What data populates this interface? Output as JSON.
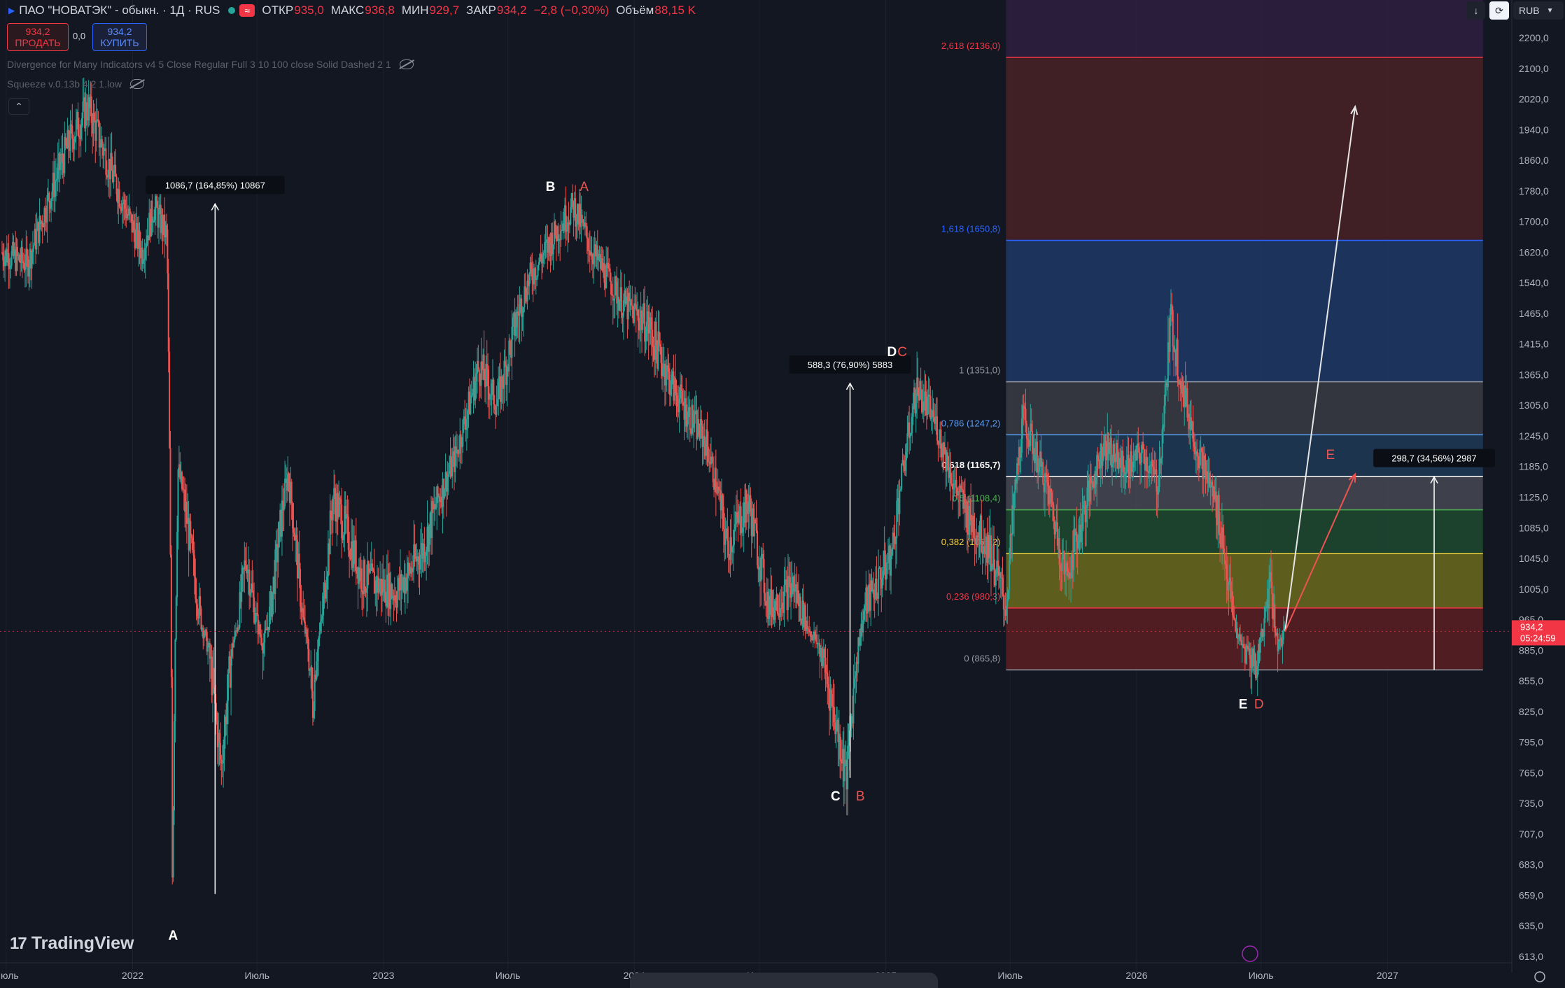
{
  "header": {
    "symbol": "ПАО \"НОВАТЭК\" - обыкн. · 1Д · RUS",
    "open_label": "ОТКР",
    "open": "935,0",
    "high_label": "МАКС",
    "high": "936,8",
    "low_label": "МИН",
    "low": "929,7",
    "close_label": "ЗАКР",
    "close": "934,2",
    "change": "−2,8 (−0,30%)",
    "volume_label": "Объём",
    "volume": "88,15 K",
    "badge": "≈"
  },
  "trade": {
    "sell_price": "934,2",
    "sell_label": "ПРОДАТЬ",
    "spread": "0,0",
    "buy_price": "934,2",
    "buy_label": "КУПИТЬ"
  },
  "indicators": [
    "Divergence for Many Indicators v4 5 Close Regular Full 3 10 100 close Solid Dashed 2 1",
    "Squeeze v.0.13b 4 2 1.low"
  ],
  "currency": "RUB",
  "watermark": "TradingView",
  "colors": {
    "background": "#131722",
    "candle_up": "#26a69a",
    "candle_down": "#ef5350",
    "last_price": "#f23645",
    "fib_236": "#f23645",
    "fib_382": "#f5d33b",
    "fib_618": "#ffffff",
    "fib_1618": "#2962ff",
    "fib_2618": "#f23645"
  },
  "chart_data": {
    "type": "candlestick",
    "y_axis": {
      "min": 600,
      "max": 2230,
      "ticks": [
        "2200,0",
        "2100,0",
        "2020,0",
        "1940,0",
        "1860,0",
        "1780,0",
        "1700,0",
        "1620,0",
        "1540,0",
        "1465,0",
        "1415,0",
        "1365,0",
        "1305,0",
        "1245,0",
        "1185,0",
        "1125,0",
        "1085,0",
        "1045,0",
        "1005,0",
        "965,0",
        "885,0",
        "855,0",
        "825,0",
        "795,0",
        "765,0",
        "735,0",
        "707,0",
        "683,0",
        "659,0",
        "635,0",
        "613,0"
      ],
      "tick_values": [
        2200,
        2100,
        2020,
        1940,
        1860,
        1780,
        1700,
        1620,
        1540,
        1465,
        1415,
        1365,
        1305,
        1245,
        1185,
        1125,
        1085,
        1045,
        1005,
        965,
        885,
        855,
        825,
        795,
        765,
        735,
        707,
        683,
        659,
        635,
        613
      ]
    },
    "x_axis": {
      "labels": [
        "Июль",
        "2022",
        "Июль",
        "2023",
        "Июль",
        "2024",
        "Июль",
        "2025",
        "Июль",
        "2026",
        "Июль",
        "2027"
      ],
      "dates": [
        "2021-07",
        "2022-01",
        "2022-07",
        "2023-01",
        "2023-07",
        "2024-01",
        "2024-07",
        "2025-01",
        "2025-07",
        "2026-01",
        "2026-07",
        "2027-01"
      ]
    },
    "last_price": {
      "value": 934.2,
      "label": "934,2",
      "countdown": "05:24:59"
    },
    "price_path": [
      [
        "2021-06-25",
        1620
      ],
      [
        "2021-08-01",
        1590
      ],
      [
        "2021-09-01",
        1760
      ],
      [
        "2021-10-01",
        1910
      ],
      [
        "2021-10-28",
        2000
      ],
      [
        "2021-12-01",
        1830
      ],
      [
        "2022-01-15",
        1620
      ],
      [
        "2022-02-01",
        1740
      ],
      [
        "2022-02-20",
        1660
      ],
      [
        "2022-02-28",
        660
      ],
      [
        "2022-03-08",
        1180
      ],
      [
        "2022-04-15",
        930
      ],
      [
        "2022-05-10",
        770
      ],
      [
        "2022-06-15",
        1050
      ],
      [
        "2022-07-10",
        900
      ],
      [
        "2022-08-15",
        1170
      ],
      [
        "2022-09-20",
        830
      ],
      [
        "2022-10-20",
        1130
      ],
      [
        "2022-12-01",
        1020
      ],
      [
        "2023-01-20",
        1000
      ],
      [
        "2023-03-01",
        1060
      ],
      [
        "2023-04-15",
        1200
      ],
      [
        "2023-05-20",
        1380
      ],
      [
        "2023-06-15",
        1310
      ],
      [
        "2023-08-01",
        1550
      ],
      [
        "2023-09-15",
        1690
      ],
      [
        "2023-10-05",
        1740
      ],
      [
        "2023-11-01",
        1620
      ],
      [
        "2023-12-15",
        1490
      ],
      [
        "2024-01-20",
        1450
      ],
      [
        "2024-03-01",
        1330
      ],
      [
        "2024-04-15",
        1230
      ],
      [
        "2024-05-15",
        1060
      ],
      [
        "2024-06-15",
        1120
      ],
      [
        "2024-07-15",
        980
      ],
      [
        "2024-08-20",
        1010
      ],
      [
        "2024-10-01",
        880
      ],
      [
        "2024-11-05",
        760
      ],
      [
        "2024-12-01",
        980
      ],
      [
        "2025-01-10",
        1050
      ],
      [
        "2025-02-15",
        1340
      ],
      [
        "2025-03-15",
        1270
      ],
      [
        "2025-04-10",
        1150
      ],
      [
        "2025-05-01",
        1100
      ],
      [
        "2025-06-01",
        1060
      ],
      [
        "2025-06-25",
        980
      ],
      [
        "2025-07-20",
        1280
      ],
      [
        "2025-08-20",
        1160
      ],
      [
        "2025-09-20",
        1020
      ],
      [
        "2025-10-15",
        1100
      ],
      [
        "2025-11-15",
        1230
      ],
      [
        "2025-12-15",
        1180
      ],
      [
        "2026-01-10",
        1210
      ],
      [
        "2026-02-01",
        1150
      ],
      [
        "2026-02-20",
        1460
      ],
      [
        "2026-03-10",
        1330
      ],
      [
        "2026-04-01",
        1210
      ],
      [
        "2026-05-01",
        1100
      ],
      [
        "2026-06-01",
        900
      ],
      [
        "2026-06-25",
        870
      ],
      [
        "2026-07-15",
        1030
      ],
      [
        "2026-07-25",
        900
      ],
      [
        "2026-08-05",
        934
      ]
    ],
    "wave_labels_white": [
      {
        "text": "A",
        "date": "2022-03-01",
        "value": 625
      },
      {
        "text": "B",
        "date": "2023-09-01",
        "value": 1780
      },
      {
        "text": "C",
        "date": "2024-10-20",
        "value": 738
      },
      {
        "text": "D",
        "date": "2025-01-10",
        "value": 1395
      },
      {
        "text": "E",
        "date": "2026-06-05",
        "value": 828
      }
    ],
    "wave_labels_red": [
      {
        "text": "A",
        "date": "2023-10-20",
        "value": 1780
      },
      {
        "text": "B",
        "date": "2024-11-25",
        "value": 738
      },
      {
        "text": "C",
        "date": "2025-01-25",
        "value": 1395
      },
      {
        "text": "D",
        "date": "2026-06-28",
        "value": 828
      },
      {
        "text": "E",
        "date": "2026-10-10",
        "value": 1200
      }
    ],
    "measures": [
      {
        "label": "1086,7 (164,85%) 10867",
        "date": "2022-05-01",
        "from": 660,
        "to": 1746
      },
      {
        "label": "588,3 (76,90%) 5883",
        "date": "2024-11-10",
        "from": 760,
        "to": 1348
      },
      {
        "label": "298,7 (34,56%) 2987",
        "date": "2027-03-10",
        "from": 865.8,
        "to": 1164.5
      }
    ],
    "projection_white": [
      [
        "2026-08-05",
        934
      ],
      [
        "2026-11-15",
        2000
      ]
    ],
    "projection_red": [
      [
        "2026-08-05",
        934
      ],
      [
        "2026-11-15",
        1170
      ]
    ],
    "fib": {
      "start_date": "2025-06-25",
      "end_date": "2027-05-20",
      "levels": [
        {
          "ratio": "0",
          "value": 865.8,
          "label": "0 (865,8)",
          "color": "#9598a1",
          "fill": "#5a1e22"
        },
        {
          "ratio": "0,236",
          "value": 980.3,
          "label": "0,236 (980,3)",
          "color": "#f23645",
          "fill": "#6b6a1c"
        },
        {
          "ratio": "0,382",
          "value": 1051.2,
          "label": "0,382 (1051,2)",
          "color": "#f5d33b",
          "fill": "#1f4a30"
        },
        {
          "ratio": "0,5",
          "value": 1108.4,
          "label": "0,5 (1108,4)",
          "color": "#4caf50",
          "fill": "#464952"
        },
        {
          "ratio": "0,618",
          "value": 1165.7,
          "label": "0,618 (1165,7)",
          "color": "#ffffff",
          "fill": "#1f3a55"
        },
        {
          "ratio": "0,786",
          "value": 1247.2,
          "label": "0,786 (1247,2)",
          "color": "#5b9cf5",
          "fill": "#3a3c44"
        },
        {
          "ratio": "1",
          "value": 1351.0,
          "label": "1 (1351,0)",
          "color": "#9598a1",
          "fill": "#1e3a66"
        },
        {
          "ratio": "1,618",
          "value": 1650.8,
          "label": "1,618 (1650,8)",
          "color": "#2962ff",
          "fill": "#4a2226"
        },
        {
          "ratio": "2,618",
          "value": 2136.0,
          "label": "2,618 (2136,0)",
          "color": "#f23645",
          "fill": "#2f1f3f"
        }
      ]
    }
  }
}
